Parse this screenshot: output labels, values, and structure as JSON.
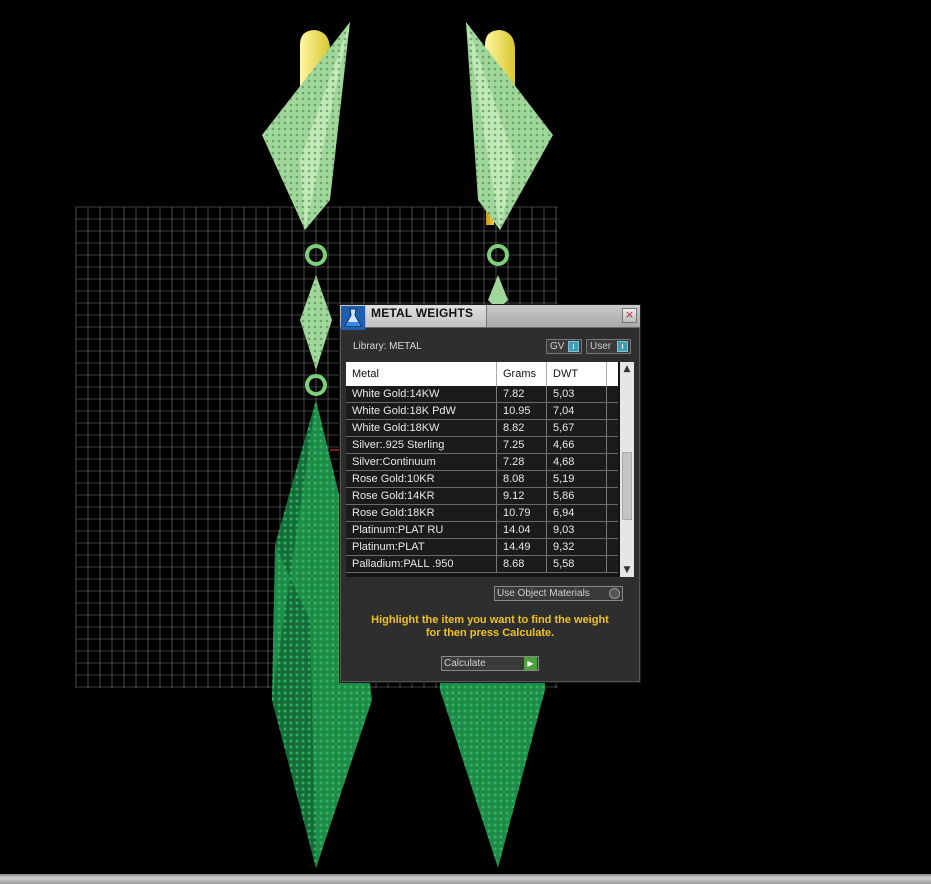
{
  "dialog": {
    "title": "METAL WEIGHTS",
    "close_label": "×",
    "library_label": "Library: METAL",
    "gv_label": "GV",
    "user_label": "User",
    "table": {
      "headers": [
        "Metal",
        "Grams",
        "DWT"
      ],
      "rows": [
        {
          "metal": "White Gold:14KW",
          "grams": "7.82",
          "dwt": "5,03"
        },
        {
          "metal": "White Gold:18K PdW",
          "grams": "10.95",
          "dwt": "7,04"
        },
        {
          "metal": "White Gold:18KW",
          "grams": "8.82",
          "dwt": "5,67"
        },
        {
          "metal": "Silver:.925 Sterling",
          "grams": "7.25",
          "dwt": "4,66"
        },
        {
          "metal": "Silver:Continuum",
          "grams": "7.28",
          "dwt": "4,68"
        },
        {
          "metal": "Rose Gold:10KR",
          "grams": "8.08",
          "dwt": "5,19"
        },
        {
          "metal": "Rose Gold:14KR",
          "grams": "9.12",
          "dwt": "5,86"
        },
        {
          "metal": "Rose Gold:18KR",
          "grams": "10.79",
          "dwt": "6,94"
        },
        {
          "metal": "Platinum:PLAT RU",
          "grams": "14.04",
          "dwt": "9,03"
        },
        {
          "metal": "Platinum:PLAT",
          "grams": "14.49",
          "dwt": "9,32"
        },
        {
          "metal": "Palladium:PALL .950",
          "grams": "8.68",
          "dwt": "5,58"
        }
      ]
    },
    "use_object_materials_label": "Use Object Materials",
    "hint_line1": "Highlight the item you want to find the weight",
    "hint_line2": "for then press Calculate.",
    "calculate_label": "Calculate"
  },
  "colors": {
    "hint": "#f2c21c",
    "accent_toggle": "#3d9fb0",
    "calculate_arrow": "#4ca33a",
    "gem_light": "#9fd89a",
    "gem_dark": "#1f8a4a",
    "metal_yellow": "#e8e070"
  }
}
